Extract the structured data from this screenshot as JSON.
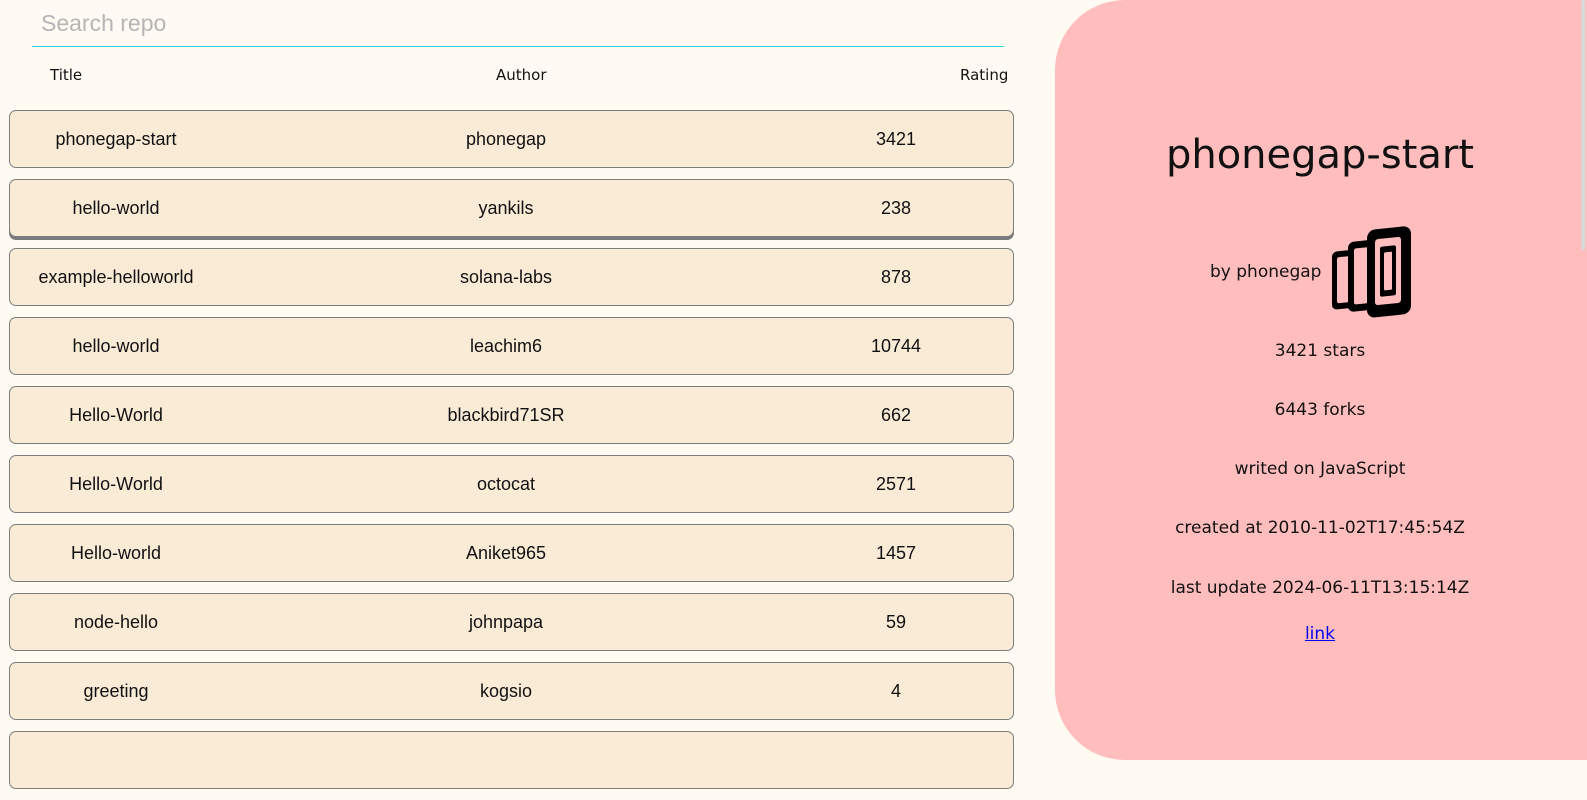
{
  "search": {
    "placeholder": "Search repo",
    "value": ""
  },
  "columns": {
    "title": "Title",
    "author": "Author",
    "rating": "Rating"
  },
  "repos": [
    {
      "title": "phonegap-start",
      "author": "phonegap",
      "rating": "3421"
    },
    {
      "title": "hello-world",
      "author": "yankils",
      "rating": "238"
    },
    {
      "title": "example-helloworld",
      "author": "solana-labs",
      "rating": "878"
    },
    {
      "title": "hello-world",
      "author": "leachim6",
      "rating": "10744"
    },
    {
      "title": "Hello-World",
      "author": "blackbird71SR",
      "rating": "662"
    },
    {
      "title": "Hello-World",
      "author": "octocat",
      "rating": "2571"
    },
    {
      "title": "Hello-world",
      "author": "Aniket965",
      "rating": "1457"
    },
    {
      "title": "node-hello",
      "author": "johnpapa",
      "rating": "59"
    },
    {
      "title": "greeting",
      "author": "kogsio",
      "rating": "4"
    },
    {
      "title": "",
      "author": "",
      "rating": ""
    }
  ],
  "hovered_row_index": 1,
  "detail": {
    "name": "phonegap-start",
    "by": "by phonegap",
    "avatar_icon": "phonegap-logo-icon",
    "stars": "3421 stars",
    "forks": "6443 forks",
    "language": "writed on JavaScript",
    "created": "created at 2010-11-02T17:45:54Z",
    "updated": "last update 2024-06-11T13:15:14Z",
    "link": "link"
  },
  "colors": {
    "page_bg": "#fffbf3",
    "row_bg": "#faebd7",
    "panel_bg": "#ffbdbe",
    "search_underline": "#33d1e6",
    "link": "#0000ee"
  }
}
